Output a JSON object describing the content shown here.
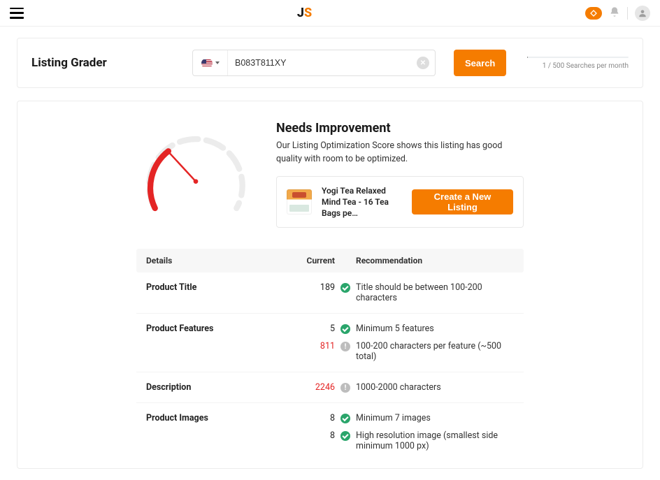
{
  "header": {
    "logo_left": "J",
    "logo_right": "S"
  },
  "search": {
    "page_title": "Listing Grader",
    "asin_value": "B083T811XY",
    "search_label": "Search",
    "quota_text": "1 / 500 Searches per month"
  },
  "overview": {
    "verdict": "Needs Improvement",
    "description": "Our Listing Optimization Score shows this listing has good quality with room to be optimized.",
    "product_name": "Yogi Tea Relaxed Mind Tea - 16 Tea Bags pe…",
    "create_label": "Create a New Listing"
  },
  "table": {
    "headers": {
      "details": "Details",
      "current": "Current",
      "recommendation": "Recommendation"
    },
    "rows": [
      {
        "label": "Product Title",
        "current": "189",
        "current_red": false,
        "status": "pass",
        "rec": "Title should be between 100-200 characters"
      },
      {
        "label": "Product Features",
        "current": "5",
        "current_red": false,
        "status": "pass",
        "rec": "Minimum 5 features",
        "sub": {
          "current": "811",
          "current_red": true,
          "status": "warn",
          "rec": "100-200 characters per feature (~500 total)"
        }
      },
      {
        "label": "Description",
        "current": "2246",
        "current_red": true,
        "status": "warn",
        "rec": "1000-2000 characters"
      },
      {
        "label": "Product Images",
        "current": "8",
        "current_red": false,
        "status": "pass",
        "rec": "Minimum 7 images",
        "sub": {
          "current": "8",
          "current_red": false,
          "status": "pass",
          "rec": "High resolution image (smallest side minimum 1000 px)"
        }
      }
    ]
  }
}
